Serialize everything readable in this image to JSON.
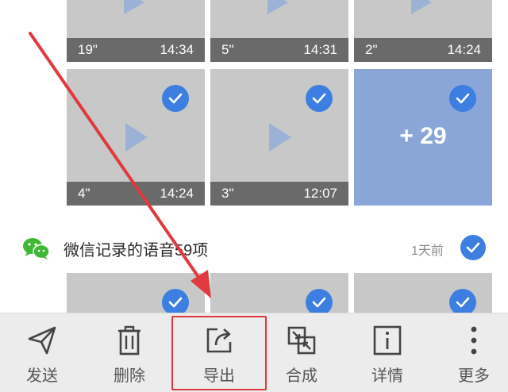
{
  "row1": [
    {
      "duration": "19\"",
      "time": "14:34"
    },
    {
      "duration": "5\"",
      "time": "14:31"
    },
    {
      "duration": "2\"",
      "time": "14:24"
    }
  ],
  "row2": [
    {
      "duration": "4\"",
      "time": "14:24"
    },
    {
      "duration": "3\"",
      "time": "12:07"
    }
  ],
  "more_tile": {
    "label": "+ 29"
  },
  "group": {
    "title": "微信记录的语音59项",
    "date": "1天前",
    "icon": "wechat-icon"
  },
  "toolbar": {
    "items": [
      {
        "label": "发送",
        "icon": "send-icon"
      },
      {
        "label": "删除",
        "icon": "trash-icon"
      },
      {
        "label": "导出",
        "icon": "export-icon"
      },
      {
        "label": "合成",
        "icon": "merge-icon"
      },
      {
        "label": "详情",
        "icon": "info-icon"
      },
      {
        "label": "更多",
        "icon": "more-vertical-icon"
      }
    ]
  },
  "colors": {
    "accent": "#3d7fe0",
    "tile": "#c8c8c8",
    "more_tile": "#8aa6d8",
    "annotation": "#e0393e"
  }
}
